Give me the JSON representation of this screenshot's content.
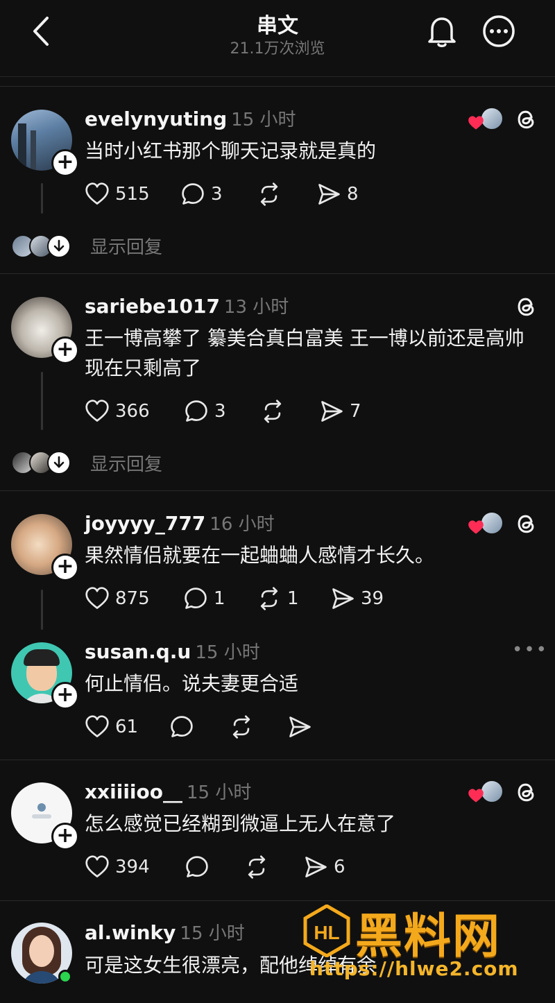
{
  "header": {
    "title": "串文",
    "views": "21.1万次浏览",
    "back_icon": "chevron-left-icon",
    "bell_icon": "bell-icon",
    "more_icon": "more-horizontal-icon"
  },
  "posts": [
    {
      "username": "evelynyuting",
      "time": "15 小时",
      "text": "当时小红书那个聊天记录就是真的",
      "likes": "515",
      "replies": "3",
      "reposts": "",
      "shares": "8",
      "show_replies": "显示回复",
      "liked_by_author": true
    },
    {
      "username": "sariebe1017",
      "time": "13 小时",
      "text": "王一博高攀了 纂美合真白富美 王一博以前还是高帅 现在只剩高了",
      "likes": "366",
      "replies": "3",
      "reposts": "",
      "shares": "7",
      "show_replies": "显示回复",
      "liked_by_author": false
    },
    {
      "username": "joyyyy_777",
      "time": "16 小时",
      "text": "果然情侣就要在一起蛐蛐人感情才长久。",
      "likes": "875",
      "replies": "1",
      "reposts": "1",
      "shares": "39",
      "liked_by_author": true
    },
    {
      "username": "susan.q.u",
      "time": "15 小时",
      "text": "何止情侣。说夫妻更合适",
      "likes": "61",
      "replies": "",
      "reposts": "",
      "shares": "",
      "more": "•••"
    },
    {
      "username": "xxiiiioo__",
      "time": "15 小时",
      "text": "怎么感觉已经糊到微逼上无人在意了",
      "likes": "394",
      "replies": "",
      "reposts": "",
      "shares": "6",
      "liked_by_author": true
    },
    {
      "username": "al.winky",
      "time": "15 小时",
      "text": "可是这女生很漂亮，配他绰绰有余"
    }
  ],
  "watermark": {
    "text": "黑料网",
    "url": "https://hlwe2.com",
    "logo_text": "HL"
  },
  "colors": {
    "background": "#101010",
    "text": "#f3f3f3",
    "muted": "#777777",
    "heart": "#ff2d55",
    "watermark": "#f4a91c"
  }
}
